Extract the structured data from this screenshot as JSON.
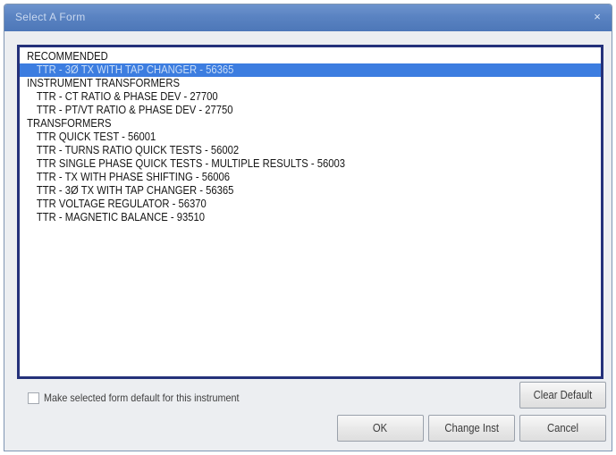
{
  "window": {
    "title": "Select A Form",
    "close_glyph": "×"
  },
  "form_list": {
    "rows": [
      {
        "type": "group",
        "text": "RECOMMENDED"
      },
      {
        "type": "item",
        "text": "TTR - 3Ø TX WITH TAP CHANGER - 56365",
        "selected": true
      },
      {
        "type": "group",
        "text": "INSTRUMENT TRANSFORMERS"
      },
      {
        "type": "item",
        "text": "TTR - CT RATIO & PHASE DEV - 27700"
      },
      {
        "type": "item",
        "text": "TTR - PT/VT RATIO & PHASE DEV - 27750"
      },
      {
        "type": "group",
        "text": "TRANSFORMERS"
      },
      {
        "type": "item",
        "text": "TTR QUICK TEST - 56001"
      },
      {
        "type": "item",
        "text": "TTR - TURNS RATIO QUICK TESTS - 56002"
      },
      {
        "type": "item",
        "text": "TTR SINGLE PHASE QUICK TESTS - MULTIPLE RESULTS - 56003"
      },
      {
        "type": "item",
        "text": "TTR - TX WITH PHASE SHIFTING - 56006"
      },
      {
        "type": "item",
        "text": "TTR - 3Ø TX WITH TAP CHANGER - 56365"
      },
      {
        "type": "item",
        "text": "TTR VOLTAGE REGULATOR - 56370"
      },
      {
        "type": "item",
        "text": "TTR - MAGNETIC BALANCE - 93510"
      }
    ]
  },
  "default_checkbox": {
    "label": "Make selected form default for this instrument",
    "checked": false
  },
  "buttons": {
    "clear_default": "Clear Default",
    "ok": "OK",
    "change_inst": "Change Inst",
    "cancel": "Cancel"
  },
  "colors": {
    "titlebar": "#5a83c2",
    "list_border": "#24317a",
    "selection": "#3c7de0"
  }
}
